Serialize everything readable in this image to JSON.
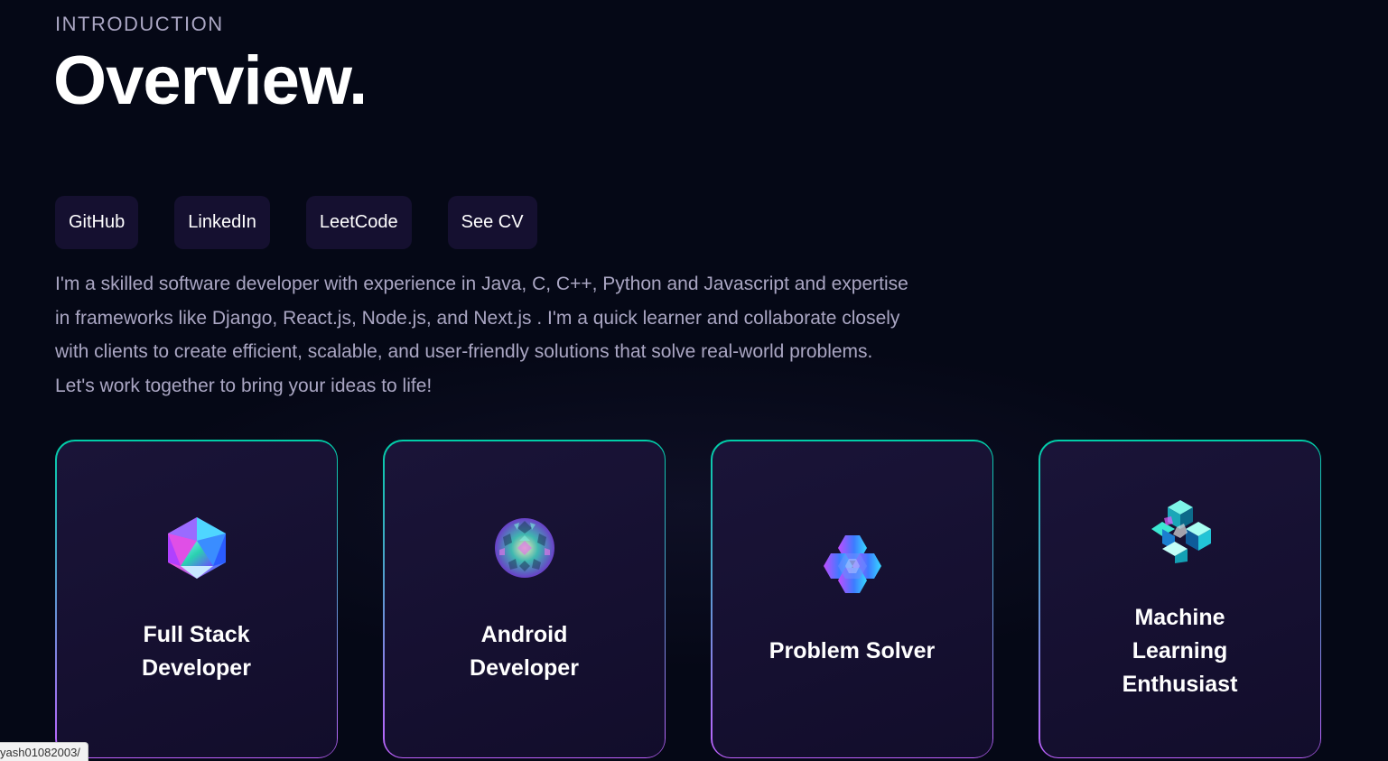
{
  "header": {
    "subtitle": "INTRODUCTION",
    "title": "Overview."
  },
  "links": [
    {
      "label": "GitHub"
    },
    {
      "label": "LinkedIn"
    },
    {
      "label": "LeetCode"
    },
    {
      "label": "See CV"
    }
  ],
  "bio": "I'm a skilled software developer with experience in Java, C, C++, Python and Javascript and expertise in frameworks like Django, React.js, Node.js, and Next.js . I'm a quick learner and collaborate closely with clients to create efficient, scalable, and user-friendly solutions that solve real-world problems. Let's work together to bring your ideas to life!",
  "services": [
    {
      "title": "Full Stack Developer",
      "icon": "icosahedron-icon"
    },
    {
      "title": "Android Developer",
      "icon": "faceted-sphere-icon"
    },
    {
      "title": "Problem Solver",
      "icon": "hexagon-cluster-icon"
    },
    {
      "title": "Machine Learning Enthusiast",
      "icon": "lattice-cube-icon"
    }
  ],
  "status_bar": {
    "url": "yash01082003/"
  },
  "colors": {
    "background": "#050816",
    "card": "#151030",
    "gradient_start": "#00cea8",
    "gradient_end": "#bf61ff",
    "secondary_text": "#aaa6c3"
  }
}
